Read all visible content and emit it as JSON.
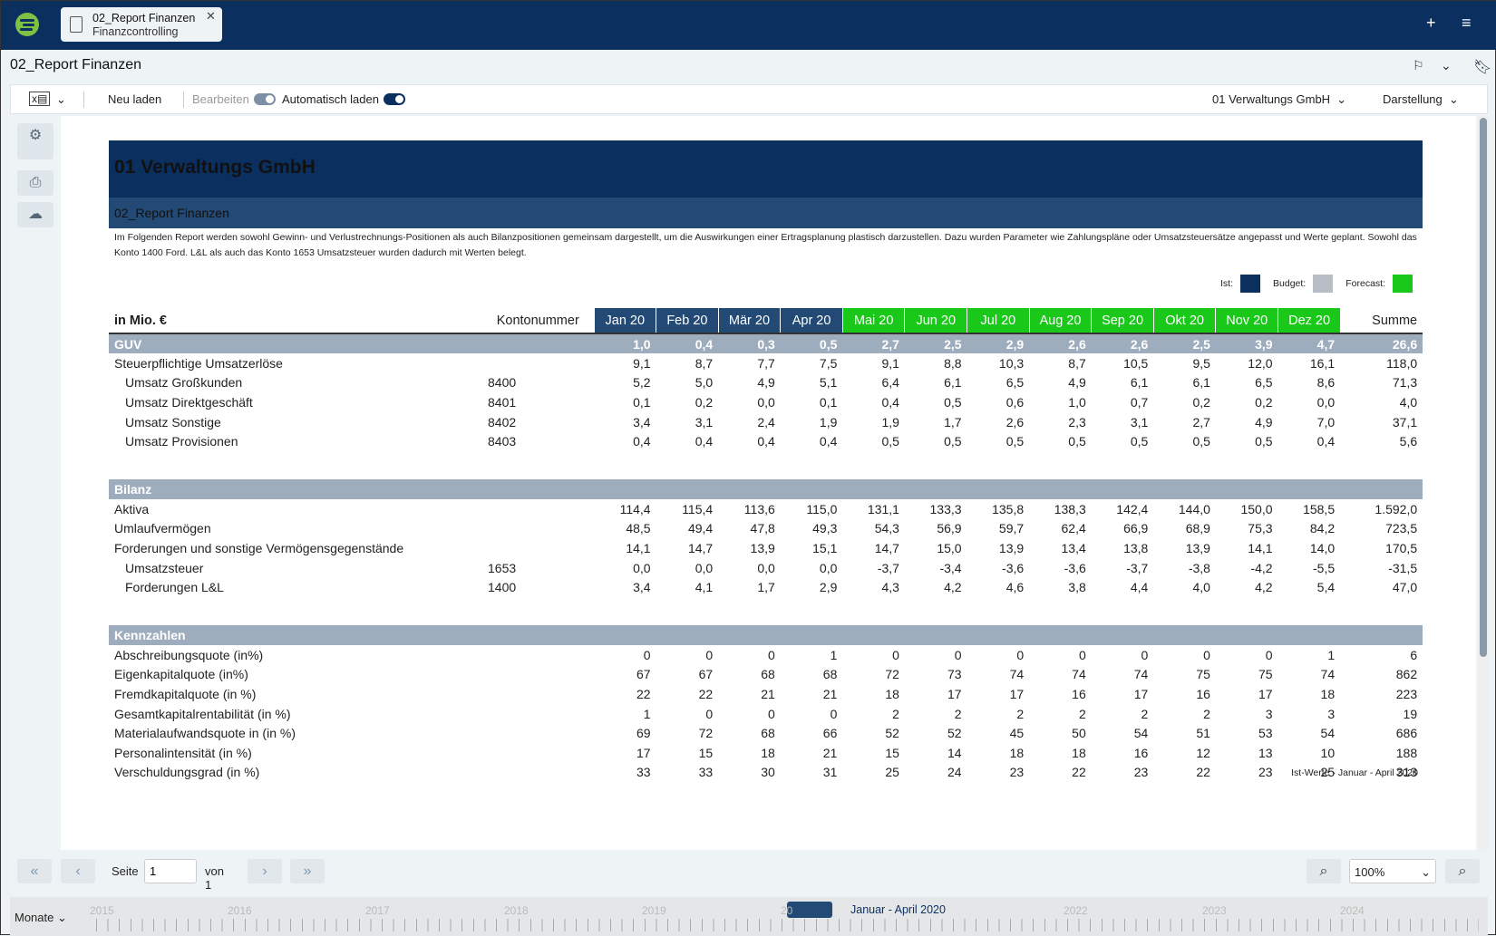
{
  "app": {
    "tab_title": "02_Report Finanzen",
    "tab_subtitle": "Finanzcontrolling",
    "page_title": "02_Report Finanzen"
  },
  "toolbar": {
    "reload": "Neu laden",
    "edit": "Bearbeiten",
    "autoload": "Automatisch laden",
    "company": "01 Verwaltungs GmbH",
    "view": "Darstellung"
  },
  "report": {
    "title": "01 Verwaltungs GmbH",
    "subtitle": "02_Report Finanzen",
    "description": "Im Folgenden Report werden sowohl Gewinn- und Verlustrechnungs-Positionen als auch Bilanzpositionen gemeinsam dargestellt, um die Auswirkungen einer Ertragsplanung plastisch darzustellen. Dazu wurden Parameter wie Zahlungspläne oder Umsatzsteuersätze angepasst und Werte geplant. Sowohl das Konto 1400 Ford. L&L als auch das Konto 1653 Umsatzsteuer wurden dadurch mit Werten belegt.",
    "legend": [
      {
        "label": "Ist:",
        "color": "#0b2f5f"
      },
      {
        "label": "Budget:",
        "color": "#b8bec6"
      },
      {
        "label": "Forecast:",
        "color": "#19c819"
      }
    ],
    "footnote": "Ist-Werte - Januar - April 2020"
  },
  "table": {
    "unit_label": "in Mio. €",
    "account_label": "Kontonummer",
    "sum_label": "Summe",
    "months": [
      "Jan 20",
      "Feb 20",
      "Mär 20",
      "Apr 20",
      "Mai 20",
      "Jun 20",
      "Jul 20",
      "Aug 20",
      "Sep 20",
      "Okt 20",
      "Nov 20",
      "Dez 20"
    ],
    "ist_color": "#234a75",
    "forecast_color": "#19c819",
    "ist_months": 4,
    "rows": [
      {
        "type": "band",
        "label": "GUV",
        "values": [
          "1,0",
          "0,4",
          "0,3",
          "0,5",
          "2,7",
          "2,5",
          "2,9",
          "2,6",
          "2,6",
          "2,5",
          "3,9",
          "4,7",
          "26,6"
        ]
      },
      {
        "label": "Steuerpflichtige Umsatzerlöse",
        "values": [
          "9,1",
          "8,7",
          "7,7",
          "7,5",
          "9,1",
          "8,8",
          "10,3",
          "8,7",
          "10,5",
          "9,5",
          "12,0",
          "16,1",
          "118,0"
        ]
      },
      {
        "label": "Umsatz Großkunden",
        "indent": true,
        "account": "8400",
        "values": [
          "5,2",
          "5,0",
          "4,9",
          "5,1",
          "6,4",
          "6,1",
          "6,5",
          "4,9",
          "6,1",
          "6,1",
          "6,5",
          "8,6",
          "71,3"
        ]
      },
      {
        "label": "Umsatz Direktgeschäft",
        "indent": true,
        "account": "8401",
        "values": [
          "0,1",
          "0,2",
          "0,0",
          "0,1",
          "0,4",
          "0,5",
          "0,6",
          "1,0",
          "0,7",
          "0,2",
          "0,2",
          "0,0",
          "4,0"
        ]
      },
      {
        "label": "Umsatz Sonstige",
        "indent": true,
        "account": "8402",
        "values": [
          "3,4",
          "3,1",
          "2,4",
          "1,9",
          "1,9",
          "1,7",
          "2,6",
          "2,3",
          "3,1",
          "2,7",
          "4,9",
          "7,0",
          "37,1"
        ]
      },
      {
        "label": "Umsatz Provisionen",
        "indent": true,
        "account": "8403",
        "values": [
          "0,4",
          "0,4",
          "0,4",
          "0,4",
          "0,5",
          "0,5",
          "0,5",
          "0,5",
          "0,5",
          "0,5",
          "0,5",
          "0,4",
          "5,6"
        ]
      },
      {
        "type": "spacer"
      },
      {
        "type": "band",
        "label": "Bilanz",
        "values": []
      },
      {
        "label": "Aktiva",
        "values": [
          "114,4",
          "115,4",
          "113,6",
          "115,0",
          "131,1",
          "133,3",
          "135,8",
          "138,3",
          "142,4",
          "144,0",
          "150,0",
          "158,5",
          "1.592,0"
        ]
      },
      {
        "label": "Umlaufvermögen",
        "values": [
          "48,5",
          "49,4",
          "47,8",
          "49,3",
          "54,3",
          "56,9",
          "59,7",
          "62,4",
          "66,9",
          "68,9",
          "75,3",
          "84,2",
          "723,5"
        ]
      },
      {
        "label": "Forderungen und sonstige Vermögensgegenstände",
        "values": [
          "14,1",
          "14,7",
          "13,9",
          "15,1",
          "14,7",
          "15,0",
          "13,9",
          "13,4",
          "13,8",
          "13,9",
          "14,1",
          "14,0",
          "170,5"
        ]
      },
      {
        "label": "Umsatzsteuer",
        "indent": true,
        "account": "1653",
        "values": [
          "0,0",
          "0,0",
          "0,0",
          "0,0",
          "-3,7",
          "-3,4",
          "-3,6",
          "-3,6",
          "-3,7",
          "-3,8",
          "-4,2",
          "-5,5",
          "-31,5"
        ]
      },
      {
        "label": "Forderungen L&L",
        "indent": true,
        "account": "1400",
        "values": [
          "3,4",
          "4,1",
          "1,7",
          "2,9",
          "4,3",
          "4,2",
          "4,6",
          "3,8",
          "4,4",
          "4,0",
          "4,2",
          "5,4",
          "47,0"
        ]
      },
      {
        "type": "spacer"
      },
      {
        "type": "band",
        "label": "Kennzahlen",
        "values": []
      },
      {
        "label": "Abschreibungsquote (in%)",
        "values": [
          "0",
          "0",
          "0",
          "1",
          "0",
          "0",
          "0",
          "0",
          "0",
          "0",
          "0",
          "1",
          "6"
        ]
      },
      {
        "label": "Eigenkapitalquote (in%)",
        "values": [
          "67",
          "67",
          "68",
          "68",
          "72",
          "73",
          "74",
          "74",
          "74",
          "75",
          "75",
          "74",
          "862"
        ]
      },
      {
        "label": "Fremdkapitalquote (in %)",
        "values": [
          "22",
          "22",
          "21",
          "21",
          "18",
          "17",
          "17",
          "16",
          "17",
          "16",
          "17",
          "18",
          "223"
        ]
      },
      {
        "label": "Gesamtkapitalrentabilität (in %)",
        "values": [
          "1",
          "0",
          "0",
          "0",
          "2",
          "2",
          "2",
          "2",
          "2",
          "2",
          "3",
          "3",
          "19"
        ]
      },
      {
        "label": "Materialaufwandsquote in (in %)",
        "values": [
          "69",
          "72",
          "68",
          "66",
          "52",
          "52",
          "45",
          "50",
          "54",
          "51",
          "53",
          "54",
          "686"
        ]
      },
      {
        "label": "Personalintensität (in %)",
        "values": [
          "17",
          "15",
          "18",
          "21",
          "15",
          "14",
          "18",
          "18",
          "16",
          "12",
          "13",
          "10",
          "188"
        ]
      },
      {
        "label": "Verschuldungsgrad (in %)",
        "values": [
          "33",
          "33",
          "30",
          "31",
          "25",
          "24",
          "23",
          "22",
          "23",
          "22",
          "23",
          "25",
          "313"
        ]
      }
    ]
  },
  "pager": {
    "page_label": "Seite",
    "page_value": "1",
    "of_label": "von 1",
    "zoom": "100%"
  },
  "timeline": {
    "unit": "Monate",
    "years": [
      "2015",
      "2016",
      "2017",
      "2018",
      "2019",
      "20",
      "2022",
      "2023",
      "2024"
    ],
    "range_label": "Januar - April 2020"
  }
}
